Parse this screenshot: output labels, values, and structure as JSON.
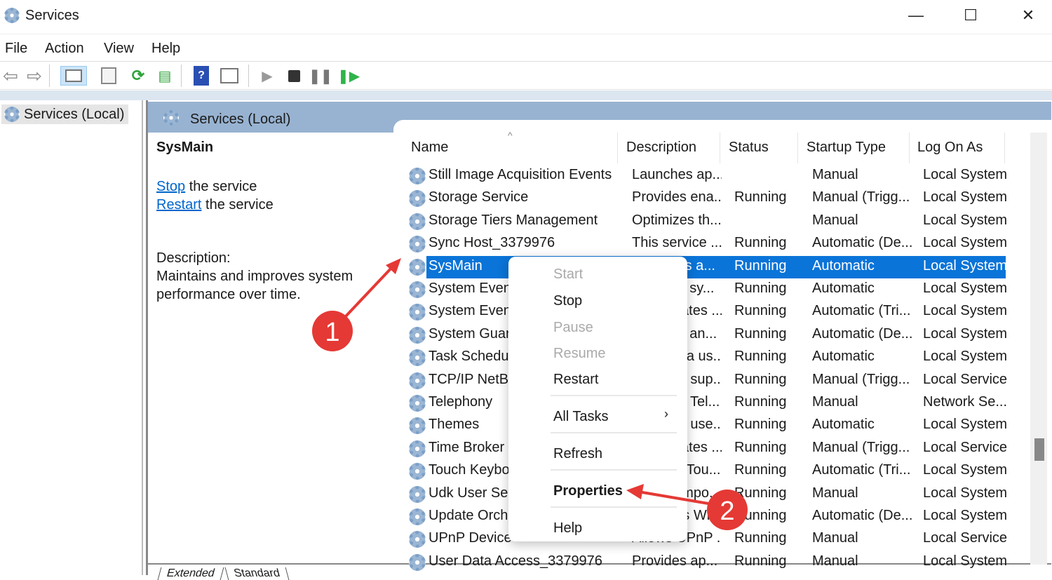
{
  "window": {
    "title": "Services",
    "minimize": "—",
    "maximize": "☐",
    "close": "✕"
  },
  "menu": [
    "File",
    "Action",
    "View",
    "Help"
  ],
  "toolbar": [
    "back-icon",
    "forward-icon",
    "show-hide-console-tree-icon",
    "properties-icon",
    "refresh-icon",
    "export-list-icon",
    "help-icon",
    "show-action-pane-icon",
    "start-service-icon",
    "stop-service-icon",
    "pause-service-icon",
    "restart-service-icon"
  ],
  "tree": {
    "item": "Services (Local)"
  },
  "pane": {
    "header": "Services (Local)"
  },
  "detail": {
    "name": "SysMain",
    "stop_link": "Stop",
    "stop_rest": " the service",
    "restart_link": "Restart",
    "restart_rest": " the service",
    "desc_label": "Description:",
    "desc_line1": "Maintains and improves system",
    "desc_line2": "performance over time."
  },
  "table": {
    "headers": [
      "Name",
      "Description",
      "Status",
      "Startup Type",
      "Log On As"
    ],
    "sort_indicator": "^",
    "rows": [
      [
        "Still Image Acquisition Events",
        "Launches ap...",
        "",
        "Manual",
        "Local System"
      ],
      [
        "Storage Service",
        "Provides ena...",
        "Running",
        "Manual (Trigg...",
        "Local System"
      ],
      [
        "Storage Tiers Management",
        "Optimizes th...",
        "",
        "Manual",
        "Local System"
      ],
      [
        "Sync Host_3379976",
        "This service ...",
        "Running",
        "Automatic (De...",
        "Local System"
      ],
      [
        "SysMain",
        "Maintains a...",
        "Running",
        "Automatic",
        "Local System"
      ],
      [
        "System Event",
        "Monitors sy...",
        "Running",
        "Automatic",
        "Local System"
      ],
      [
        "System Event",
        "Coordinates ...",
        "Running",
        "Automatic (Tri...",
        "Local System"
      ],
      [
        "System Guard",
        "Monitors an...",
        "Running",
        "Automatic (De...",
        "Local System"
      ],
      [
        "Task Schedul",
        "Enables a us...",
        "Running",
        "Automatic",
        "Local System"
      ],
      [
        "TCP/IP NetBIO",
        "Provides sup...",
        "Running",
        "Manual (Trigg...",
        "Local Service"
      ],
      [
        "Telephony",
        "Provides Tel...",
        "Running",
        "Manual",
        "Network Se..."
      ],
      [
        "Themes",
        "Provides use...",
        "Running",
        "Automatic",
        "Local System"
      ],
      [
        "Time Broker",
        "Coordinates ...",
        "Running",
        "Manual (Trigg...",
        "Local Service"
      ],
      [
        "Touch Keybo",
        "Enables Tou...",
        "Running",
        "Automatic (Tri...",
        "Local System"
      ],
      [
        "Udk User Ser",
        "Shell compo...",
        "Running",
        "Manual",
        "Local System"
      ],
      [
        "Update Orch",
        "Manages Wi...",
        "Running",
        "Automatic (De...",
        "Local System"
      ],
      [
        "UPnP Device",
        "Allows UPnP ...",
        "Running",
        "Manual",
        "Local Service"
      ],
      [
        "User Data Access_3379976",
        "Provides ap...",
        "Running",
        "Manual",
        "Local System"
      ]
    ],
    "selected_index": 4
  },
  "context_menu": {
    "start": "Start",
    "stop": "Stop",
    "pause": "Pause",
    "resume": "Resume",
    "restart": "Restart",
    "all_tasks": "All Tasks",
    "submenu_arrow": "›",
    "refresh": "Refresh",
    "properties": "Properties",
    "help": "Help"
  },
  "bottom_tabs": [
    "Extended",
    "Standard"
  ],
  "annotations": {
    "step1": "1",
    "step2": "2",
    "color": "#e53935"
  },
  "colors": {
    "selection": "#0a74d8",
    "pane_header": "#98b3d1"
  }
}
